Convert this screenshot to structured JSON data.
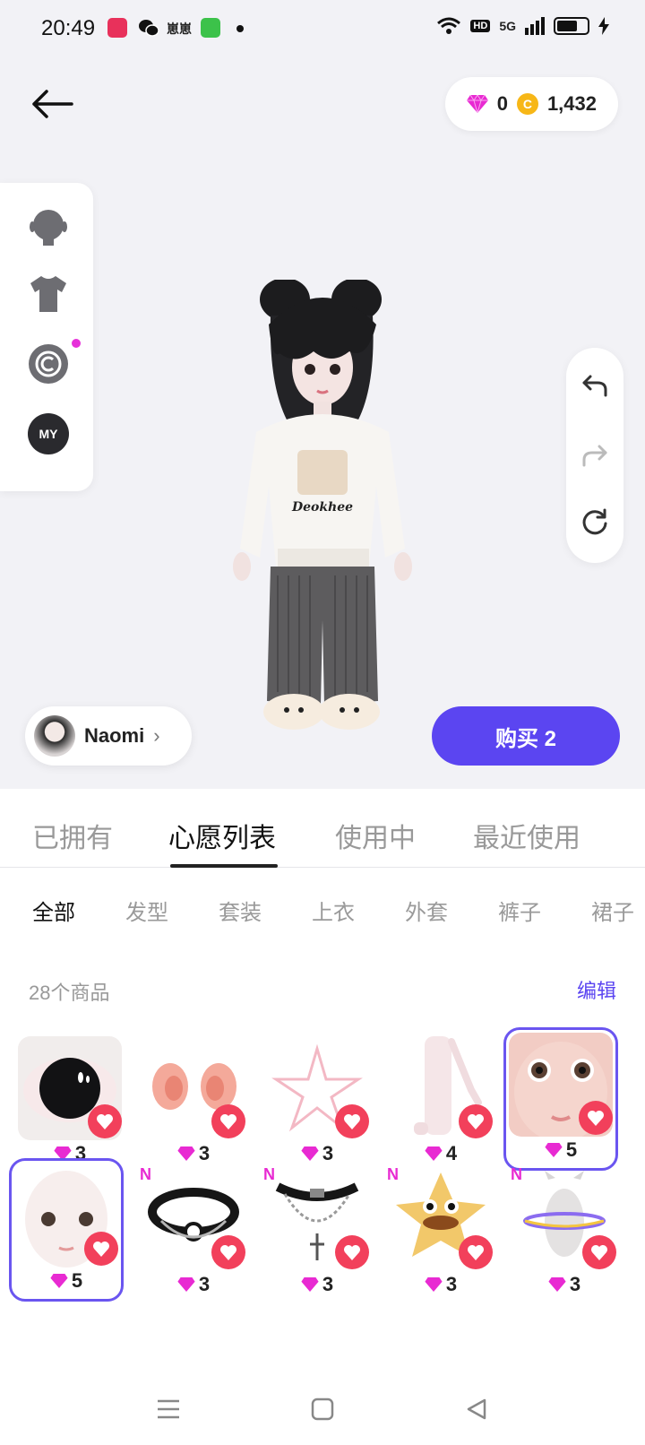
{
  "status_bar": {
    "time": "20:49",
    "network": "5G",
    "hd": "HD",
    "app_label": "崽崽"
  },
  "header": {
    "gems": "0",
    "coins": "1,432"
  },
  "profile": {
    "name": "Naomi"
  },
  "buy_button": "购买 2",
  "tabs": [
    {
      "label": "已拥有"
    },
    {
      "label": "心愿列表"
    },
    {
      "label": "使用中"
    },
    {
      "label": "最近使用"
    }
  ],
  "categories": [
    {
      "label": "全部"
    },
    {
      "label": "发型"
    },
    {
      "label": "套装"
    },
    {
      "label": "上衣"
    },
    {
      "label": "外套"
    },
    {
      "label": "裤子"
    },
    {
      "label": "裙子"
    }
  ],
  "list_header": {
    "count": "28个商品",
    "edit": "编辑"
  },
  "items": [
    {
      "price": "3",
      "icon": "eye-item"
    },
    {
      "price": "3",
      "icon": "ears-item"
    },
    {
      "price": "3",
      "icon": "star-item"
    },
    {
      "price": "4",
      "icon": "body-item"
    },
    {
      "price": "5",
      "icon": "face-item-1",
      "selected": true
    },
    {
      "price": "5",
      "icon": "face-item-2",
      "selected": true
    },
    {
      "price": "3",
      "icon": "choker-item",
      "badge": "N"
    },
    {
      "price": "3",
      "icon": "chain-necklace-item",
      "badge": "N"
    },
    {
      "price": "3",
      "icon": "star-plush-item",
      "badge": "N"
    },
    {
      "price": "3",
      "icon": "cat-hoop-item",
      "badge": "N"
    }
  ],
  "colors": {
    "accent": "#5b45f1",
    "heart": "#f2405b",
    "gem": "#e82ad2",
    "coin": "#f7b717"
  }
}
